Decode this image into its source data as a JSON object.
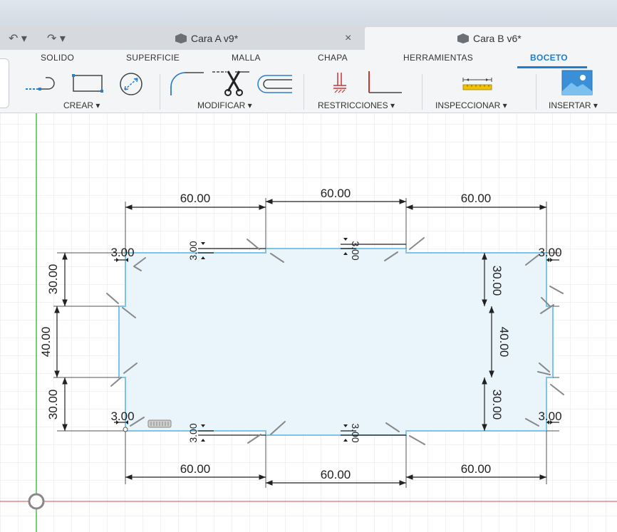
{
  "window": {
    "tabs": [
      {
        "label": "Cara A v9*",
        "close": "×"
      },
      {
        "label": "Cara B v6*"
      }
    ],
    "undo": "↶ ▾",
    "redo": "↷ ▾"
  },
  "toolbar": {
    "tabs": [
      "SOLIDO",
      "SUPERFICIE",
      "MALLA",
      "CHAPA",
      "HERRAMIENTAS",
      "BOCETO"
    ],
    "active_tab": "BOCETO",
    "groups": [
      "CREAR ▾",
      "MODIFICAR ▾",
      "RESTRICCIONES ▾",
      "INSPECCIONAR ▾",
      "INSERTAR ▾"
    ],
    "icons": [
      "line-icon",
      "rectangle-icon",
      "circle-icon",
      "fillet-icon",
      "trim-icon",
      "offset-icon",
      "coincident-icon",
      "perpendicular-icon",
      "measure-icon",
      "insert-image-icon"
    ]
  },
  "sketch": {
    "accent": "#7dc4e8",
    "fill": "#eaf4fb",
    "dimensions": {
      "top": [
        "60.00",
        "60.00",
        "60.00"
      ],
      "bottom": [
        "60.00",
        "60.00",
        "60.00"
      ],
      "left": [
        "30.00",
        "40.00",
        "30.00"
      ],
      "right": [
        "30.00",
        "40.00",
        "30.00"
      ],
      "small_top_left": "3.00",
      "small_top_right": "3.00",
      "small_bottom_left": "3.00",
      "small_bottom_right": "3.00",
      "notch_top_1": "3.00",
      "notch_top_2": "3.00",
      "notch_bottom_1": "3.00",
      "notch_bottom_2": "3.00"
    }
  },
  "colors": {
    "axis_green": "#44c244",
    "axis_red": "#e07070",
    "grid": "#e2e5e8",
    "active_blue": "#1a7fd1"
  }
}
